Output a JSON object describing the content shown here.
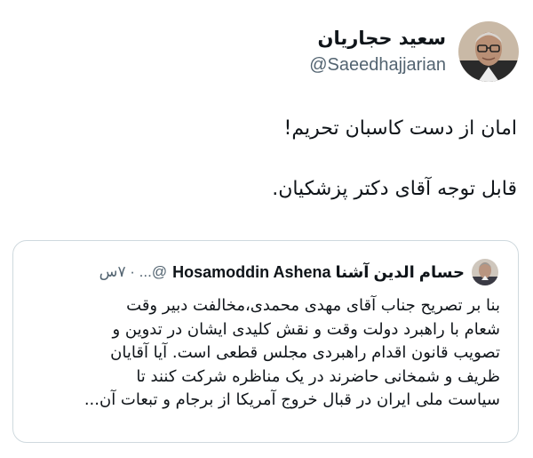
{
  "author": {
    "display_name": "سعید حجاریان",
    "handle": "@Saeedhajjarian"
  },
  "tweet": {
    "line1": "امان از دست کاسبان تحریم!",
    "line2": "قابل توجه آقای دکتر پزشکیان."
  },
  "quoted": {
    "display_name": "Hosamoddin Ashena حسام الدین آشنا",
    "meta": "@... · ۷س",
    "lines": [
      "بنا بر تصریح جناب آقای مهدی محمدی،مخالفت  دبیر وقت",
      "شعام با راهبرد دولت وقت و نقش کلیدی ایشان در تدوین و",
      "تصویب قانون اقدام راهبردی مجلس قطعی است. آیا  آقایان",
      "ظریف و شمخانی حاضرند در یک مناظره شرکت کنند تا",
      "سیاست ملی ایران در قبال خروج آمریکا از برجام و تبعات آن..."
    ]
  }
}
